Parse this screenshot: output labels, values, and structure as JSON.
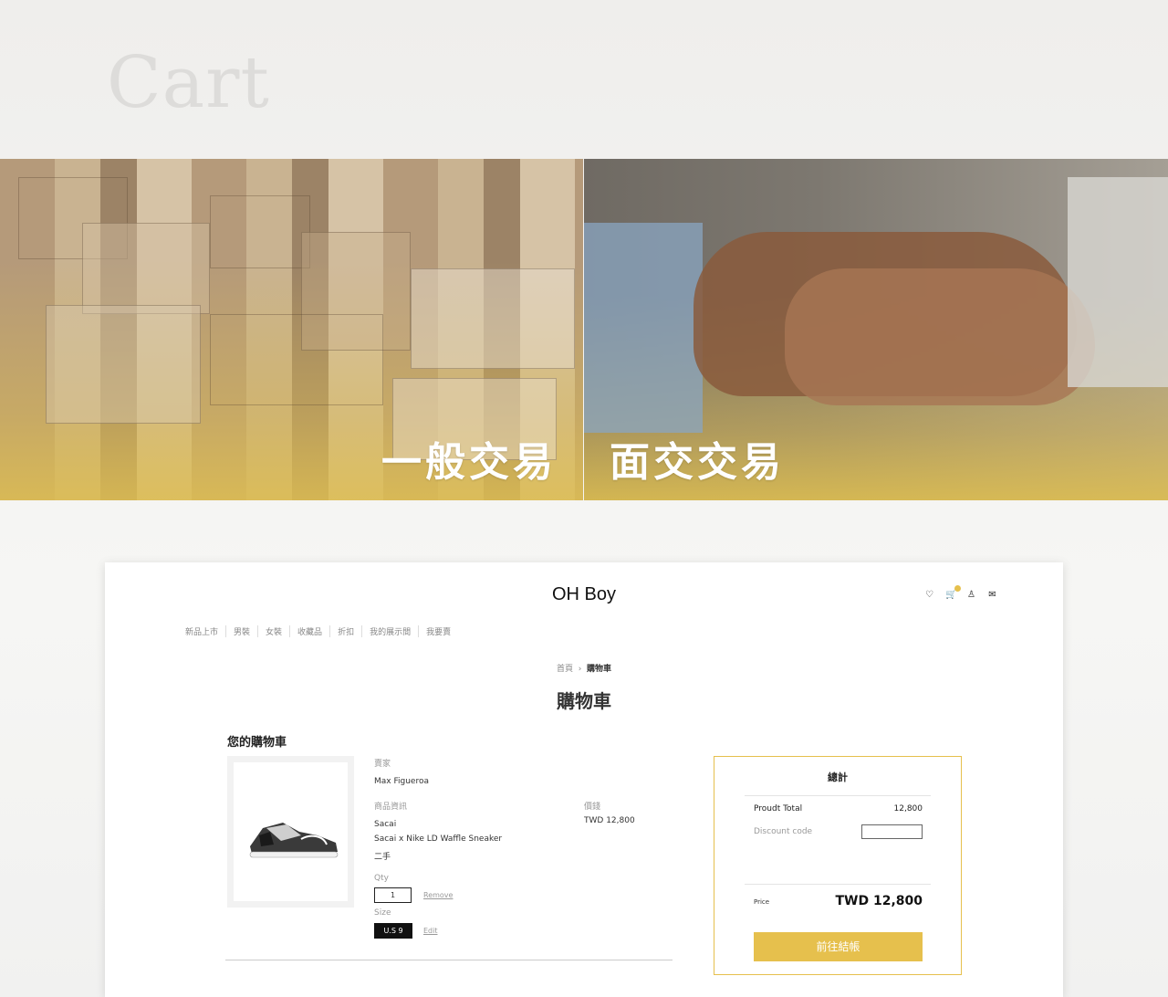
{
  "hero": {
    "title": "Cart"
  },
  "banner": {
    "left_label": "一般交易",
    "right_label": "面交交易"
  },
  "site": {
    "logo": "OH Boy",
    "icons": [
      "heart-icon",
      "cart-icon",
      "user-icon",
      "chat-icon"
    ]
  },
  "nav": {
    "items": [
      "新品上市",
      "男裝",
      "女裝",
      "收藏品",
      "折扣",
      "我的展示間",
      "我要賣"
    ]
  },
  "breadcrumb": {
    "home": "首頁",
    "sep": "›",
    "current": "購物車"
  },
  "page": {
    "title": "購物車",
    "section_title": "您的購物車"
  },
  "item": {
    "seller_label": "賣家",
    "seller": "Max Figueroa",
    "info_label": "商品資訊",
    "brand": "Sacai",
    "name": "Sacai x Nike LD Waffle Sneaker",
    "condition": "二手",
    "price_label": "價錢",
    "price": "TWD 12,800",
    "qty_label": "Qty",
    "qty": "1",
    "remove": "Remove",
    "size_label": "Size",
    "size": "U.S 9",
    "edit": "Edit"
  },
  "summary": {
    "title": "總計",
    "product_total_label": "Proudt Total",
    "product_total": "12,800",
    "discount_label": "Discount code",
    "price_label": "Price",
    "price": "TWD 12,800",
    "checkout": "前往結帳"
  },
  "colors": {
    "accent": "#e6c04d"
  }
}
